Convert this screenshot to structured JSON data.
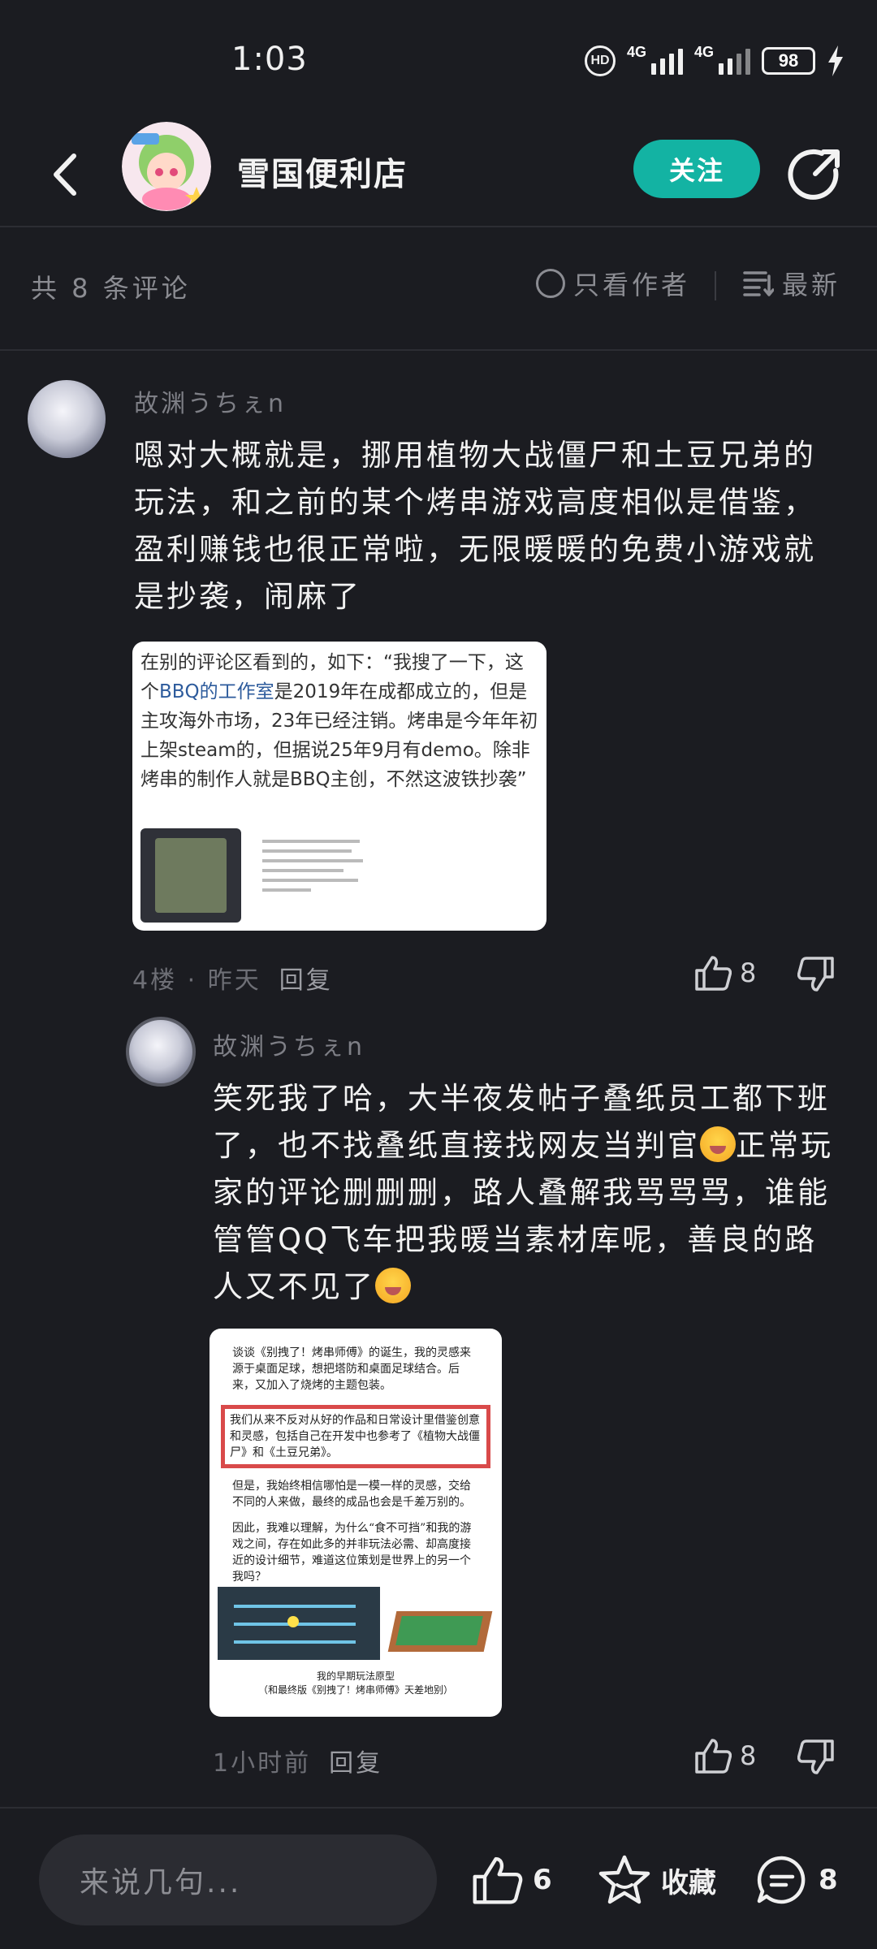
{
  "status": {
    "time": "1:03",
    "net1": "4G",
    "net2": "4G",
    "battery": "98",
    "hd": "HD"
  },
  "header": {
    "title": "雪国便利店",
    "follow_label": "关注"
  },
  "filter": {
    "count": "共 8 条评论",
    "author_only": "只看作者",
    "sort": "最新"
  },
  "comments": [
    {
      "user": "故渊うちぇn",
      "text": "嗯对大概就是，挪用植物大战僵尸和土豆兄弟的玩法，和之前的某个烤串游戏高度相似是借鉴，盈利赚钱也很正常啦，无限暖暖的免费小游戏就是抄袭，闹麻了",
      "image": {
        "text_a": "在别的评论区看到的，如下：“我搜了一下，这个",
        "link": "BBQ的工作室",
        "text_b": "是2019年在成都成立的，但是主攻海外市场，23年已经注销。烤串是今年年初上架steam的，但据说25年9月有demo。除非烤串的制作人就是BBQ主创，不然这波铁抄袭”"
      },
      "meta": {
        "floor": "4楼 · 昨天",
        "reply": "回复"
      },
      "likes": "8"
    },
    {
      "user": "故渊うちぇn",
      "text_a": "笑死我了哈，大半夜发帖子叠纸员工都下班了，也不找叠纸直接找网友当判官",
      "text_b": "正常玩家的评论删删删，路人叠解我骂骂骂，谁能管管QQ飞车把我暖当素材库呢，善良的路人又不见了",
      "image": {
        "p1": "谈谈《别拽了！烤串师傅》的诞生，我的灵感来源于桌面足球，想把塔防和桌面足球结合。后来，又加入了烧烤的主题包装。",
        "p2": "我们从来不反对从好的作品和日常设计里借鉴创意和灵感，包括自己在开发中也参考了《植物大战僵尸》和《土豆兄弟》。",
        "p3": "但是，我始终相信哪怕是一模一样的灵感，交给不同的人来做，最终的成品也会是千差万别的。",
        "p4": "因此，我难以理解，为什么“食不可挡”和我的游戏之间，存在如此多的并非玩法必需、却高度接近的设计细节，难道这位策划是世界上的另一个我吗？",
        "caption1": "我的早期玩法原型",
        "caption2": "（和最终版《别拽了！烤串师傅》天差地别）"
      },
      "meta": {
        "floor": "1小时前",
        "reply": "回复"
      },
      "likes": "8"
    }
  ],
  "bottom": {
    "placeholder": "来说几句...",
    "likes": "6",
    "fav_label": "收藏",
    "comments": "8"
  },
  "colors": {
    "accent": "#13b3a3",
    "background": "#1b1c21"
  }
}
